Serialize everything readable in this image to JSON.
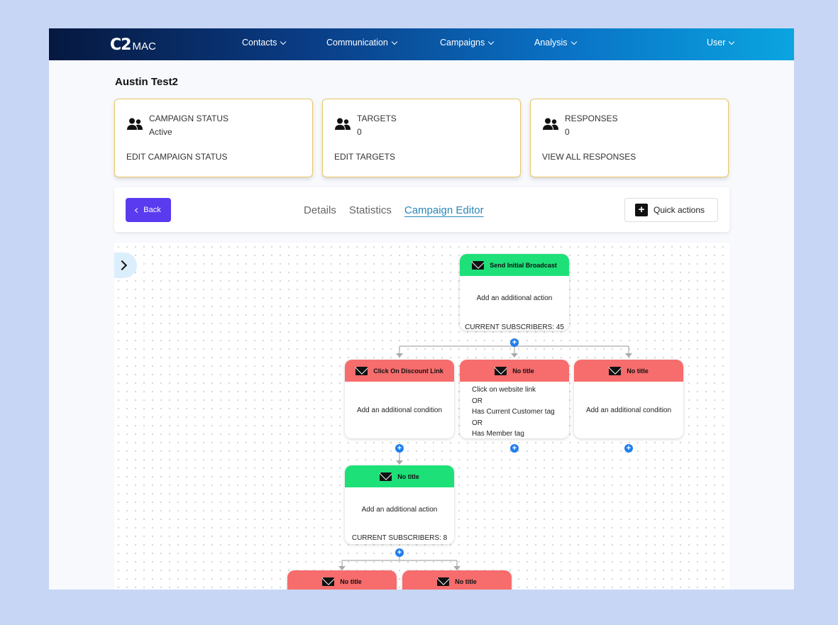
{
  "app": {
    "logo_mark": "C2",
    "logo_text": "MAC"
  },
  "nav": {
    "items": [
      {
        "label": "Contacts"
      },
      {
        "label": "Communication"
      },
      {
        "label": "Campaigns"
      },
      {
        "label": "Analysis"
      }
    ],
    "user": "User"
  },
  "page": {
    "title": "Austin Test2"
  },
  "cards": [
    {
      "label": "CAMPAIGN STATUS",
      "value": "Active",
      "action": "EDIT CAMPAIGN STATUS",
      "icon": "users-icon"
    },
    {
      "label": "TARGETS",
      "value": "0",
      "action": "EDIT TARGETS",
      "icon": "users-icon"
    },
    {
      "label": "RESPONSES",
      "value": "0",
      "action": "VIEW ALL RESPONSES",
      "icon": "users-icon"
    }
  ],
  "toolbar": {
    "back_label": "Back",
    "tabs": [
      {
        "label": "Details"
      },
      {
        "label": "Statistics"
      },
      {
        "label": "Campaign Editor",
        "active": true
      }
    ],
    "quick_actions_label": "Quick actions"
  },
  "flow": {
    "colors": {
      "action": "#1ee079",
      "condition": "#f76c6c",
      "add_button": "#1f7ef0"
    },
    "add_symbol": "+",
    "nodes": [
      {
        "type": "action",
        "title": "Send Initial Broadcast",
        "body": "Add an additional action",
        "subscribers": "CURRENT SUBSCRIBERS: 45"
      },
      {
        "type": "condition",
        "title": "Click On Discount Link",
        "body": "Add an additional condition"
      },
      {
        "type": "condition",
        "title": "No title",
        "lines": [
          "Click on website link",
          "OR",
          "Has Current Customer tag",
          "OR",
          "Has Member tag"
        ]
      },
      {
        "type": "condition",
        "title": "No title",
        "body": "Add an additional condition"
      },
      {
        "type": "action",
        "title": "No title",
        "body": "Add an additional action",
        "subscribers": "CURRENT SUBSCRIBERS: 8"
      },
      {
        "type": "condition",
        "title": "No title"
      },
      {
        "type": "condition",
        "title": "No title"
      }
    ]
  }
}
